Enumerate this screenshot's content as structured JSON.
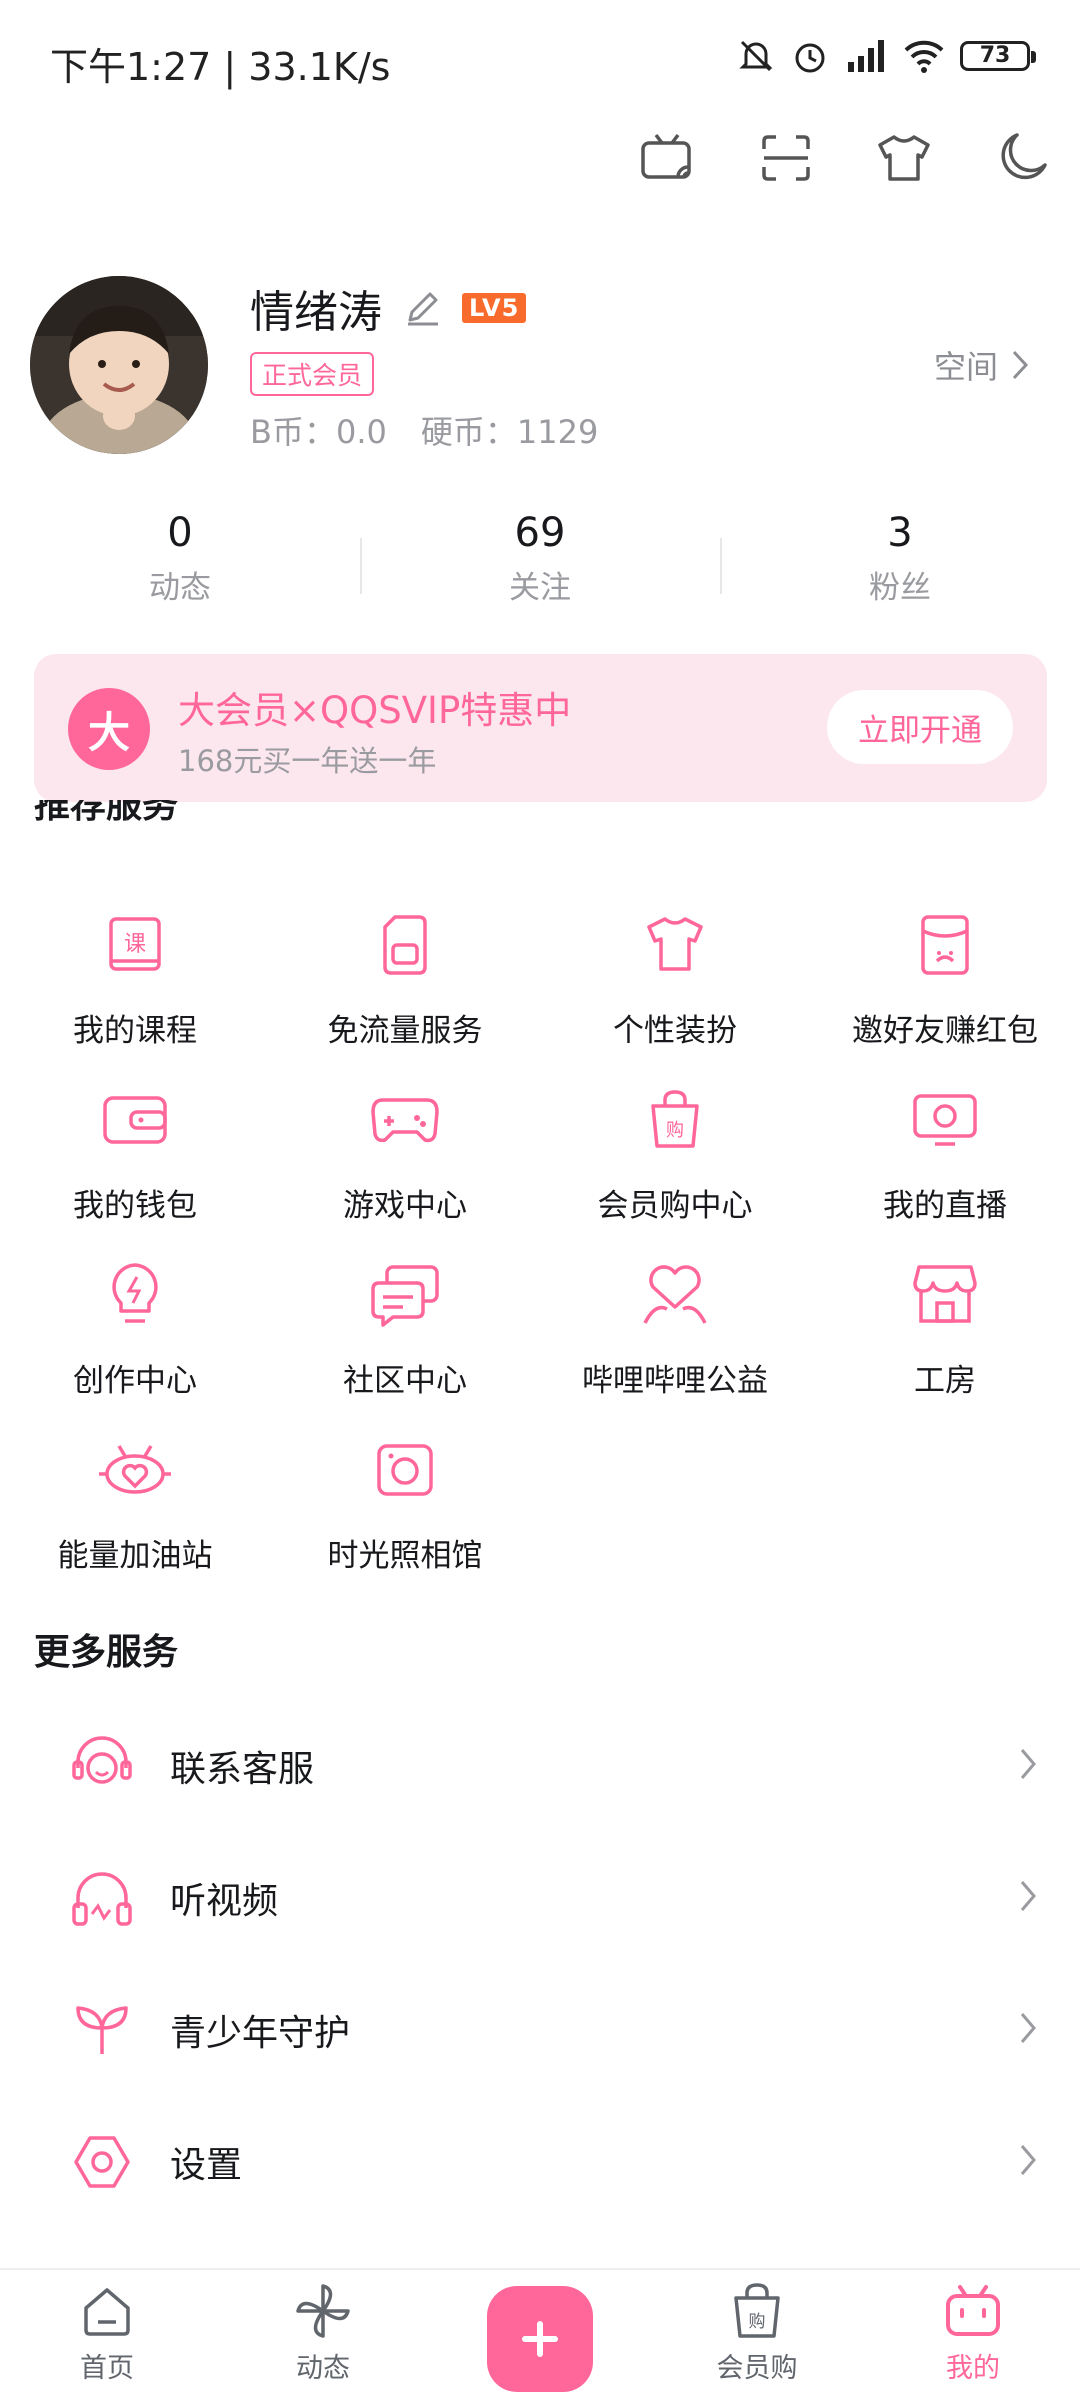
{
  "status_bar": {
    "time": "下午1:27 | 33.1K/s",
    "battery": "73"
  },
  "top_actions": [
    "tv-cast-icon",
    "scan-icon",
    "shirt-icon",
    "moon-icon"
  ],
  "profile": {
    "username": "情绪涛",
    "level": "LV5",
    "vip_tag": "正式会员",
    "b_coins": "B币：0.0",
    "hard_coins": "硬币：1129",
    "space_link": "空间"
  },
  "stats": [
    {
      "num": "0",
      "label": "动态"
    },
    {
      "num": "69",
      "label": "关注"
    },
    {
      "num": "3",
      "label": "粉丝"
    }
  ],
  "vip_banner": {
    "badge": "大",
    "title": "大会员×QQSVIP特惠中",
    "subtitle": "168元买一年送一年",
    "button": "立即开通"
  },
  "recommended_title": "推荐服务",
  "services": [
    {
      "label": "我的课程",
      "icon": "course-icon"
    },
    {
      "label": "免流量服务",
      "icon": "sim-card-icon"
    },
    {
      "label": "个性装扮",
      "icon": "shirt-icon"
    },
    {
      "label": "邀好友赚红包",
      "icon": "red-packet-icon"
    },
    {
      "label": "我的钱包",
      "icon": "wallet-icon"
    },
    {
      "label": "游戏中心",
      "icon": "gamepad-icon"
    },
    {
      "label": "会员购中心",
      "icon": "shopping-bag-icon"
    },
    {
      "label": "我的直播",
      "icon": "live-tv-icon"
    },
    {
      "label": "创作中心",
      "icon": "lightbulb-icon"
    },
    {
      "label": "社区中心",
      "icon": "chat-icon"
    },
    {
      "label": "哔哩哔哩公益",
      "icon": "heart-hands-icon"
    },
    {
      "label": "工房",
      "icon": "store-icon"
    },
    {
      "label": "能量加油站",
      "icon": "energy-heart-icon"
    },
    {
      "label": "时光照相馆",
      "icon": "camera-icon"
    }
  ],
  "more_title": "更多服务",
  "more_services": [
    {
      "label": "联系客服",
      "icon": "headset-icon"
    },
    {
      "label": "听视频",
      "icon": "headphones-icon"
    },
    {
      "label": "青少年守护",
      "icon": "sprout-icon"
    },
    {
      "label": "设置",
      "icon": "settings-icon"
    }
  ],
  "tabbar": [
    {
      "label": "首页",
      "icon": "home-icon"
    },
    {
      "label": "动态",
      "icon": "pinwheel-icon"
    },
    {
      "label": "会员购",
      "icon": "shopping-bag-icon"
    },
    {
      "label": "我的",
      "icon": "tv-mascot-icon",
      "active": true
    }
  ],
  "colors": {
    "accent": "#ff6699",
    "vip_bg": "#fde7ee",
    "level_badge": "#f86b2c"
  }
}
